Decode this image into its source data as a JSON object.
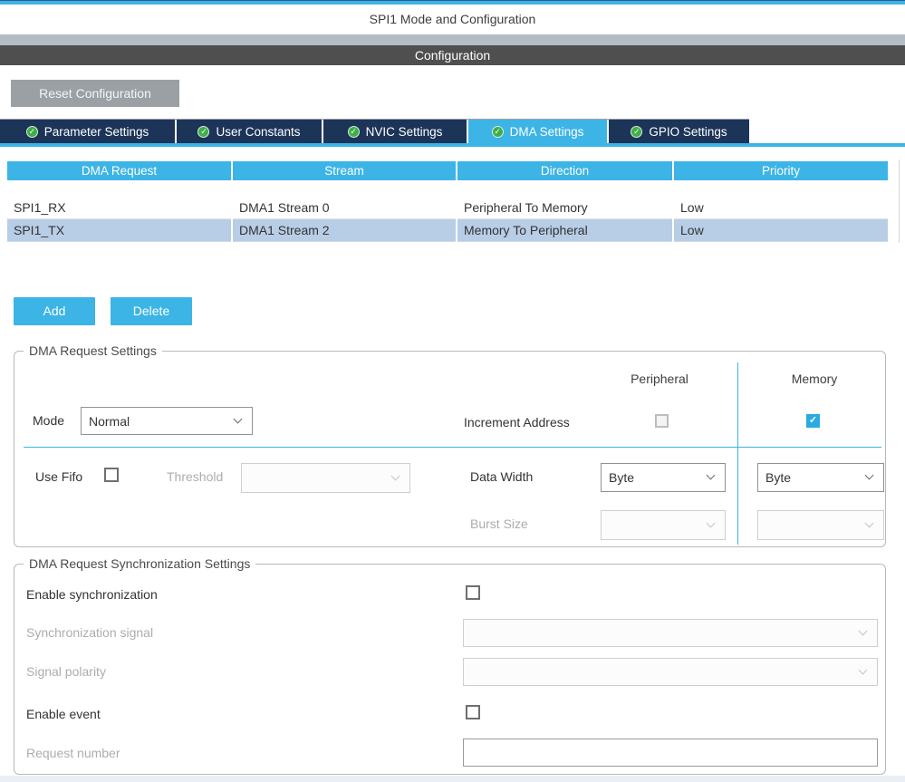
{
  "window": {
    "title": "SPI1 Mode and Configuration"
  },
  "header": {
    "section_label": "Configuration"
  },
  "toolbar": {
    "reset_label": "Reset Configuration"
  },
  "tabs": {
    "items": [
      {
        "label": "Parameter Settings",
        "active": false
      },
      {
        "label": "User Constants",
        "active": false
      },
      {
        "label": "NVIC Settings",
        "active": false
      },
      {
        "label": "DMA Settings",
        "active": true
      },
      {
        "label": "GPIO Settings",
        "active": false
      }
    ]
  },
  "dma_table": {
    "headers": [
      "DMA Request",
      "Stream",
      "Direction",
      "Priority"
    ],
    "rows": [
      {
        "dma_request": "SPI1_RX",
        "stream": "DMA1 Stream 0",
        "direction": "Peripheral To Memory",
        "priority": "Low",
        "selected": false
      },
      {
        "dma_request": "SPI1_TX",
        "stream": "DMA1 Stream 2",
        "direction": "Memory To Peripheral",
        "priority": "Low",
        "selected": true
      }
    ]
  },
  "actions": {
    "add_label": "Add",
    "delete_label": "Delete"
  },
  "request_settings": {
    "title": "DMA Request Settings",
    "peripheral_header": "Peripheral",
    "memory_header": "Memory",
    "mode": {
      "label": "Mode",
      "value": "Normal"
    },
    "increment_address": {
      "label": "Increment Address",
      "peripheral_checked": false,
      "memory_checked": true
    },
    "use_fifo": {
      "label": "Use Fifo",
      "checked": false
    },
    "threshold": {
      "label": "Threshold",
      "value": "",
      "disabled": true
    },
    "data_width": {
      "label": "Data Width",
      "peripheral_value": "Byte",
      "memory_value": "Byte"
    },
    "burst_size": {
      "label": "Burst Size",
      "peripheral_value": "",
      "memory_value": "",
      "disabled": true
    }
  },
  "sync_settings": {
    "title": "DMA Request Synchronization Settings",
    "enable_synchronization": {
      "label": "Enable synchronization",
      "checked": false
    },
    "synchronization_signal": {
      "label": "Synchronization signal",
      "value": "",
      "disabled": true
    },
    "signal_polarity": {
      "label": "Signal polarity",
      "value": "",
      "disabled": true
    },
    "enable_event": {
      "label": "Enable event",
      "checked": false
    },
    "request_number": {
      "label": "Request number",
      "value": ""
    }
  },
  "colors": {
    "accent_blue": "#3cb4e6",
    "tab_navy": "#1d3459",
    "selected_row_blue": "#b8cde6",
    "dark_bar_gray": "#4f4f4f",
    "light_bar_gray": "#b3bdc6",
    "check_green": "#3fae49",
    "checked_checkbox_blue": "#29abe2",
    "reset_button_gray": "#9aa0a4"
  }
}
